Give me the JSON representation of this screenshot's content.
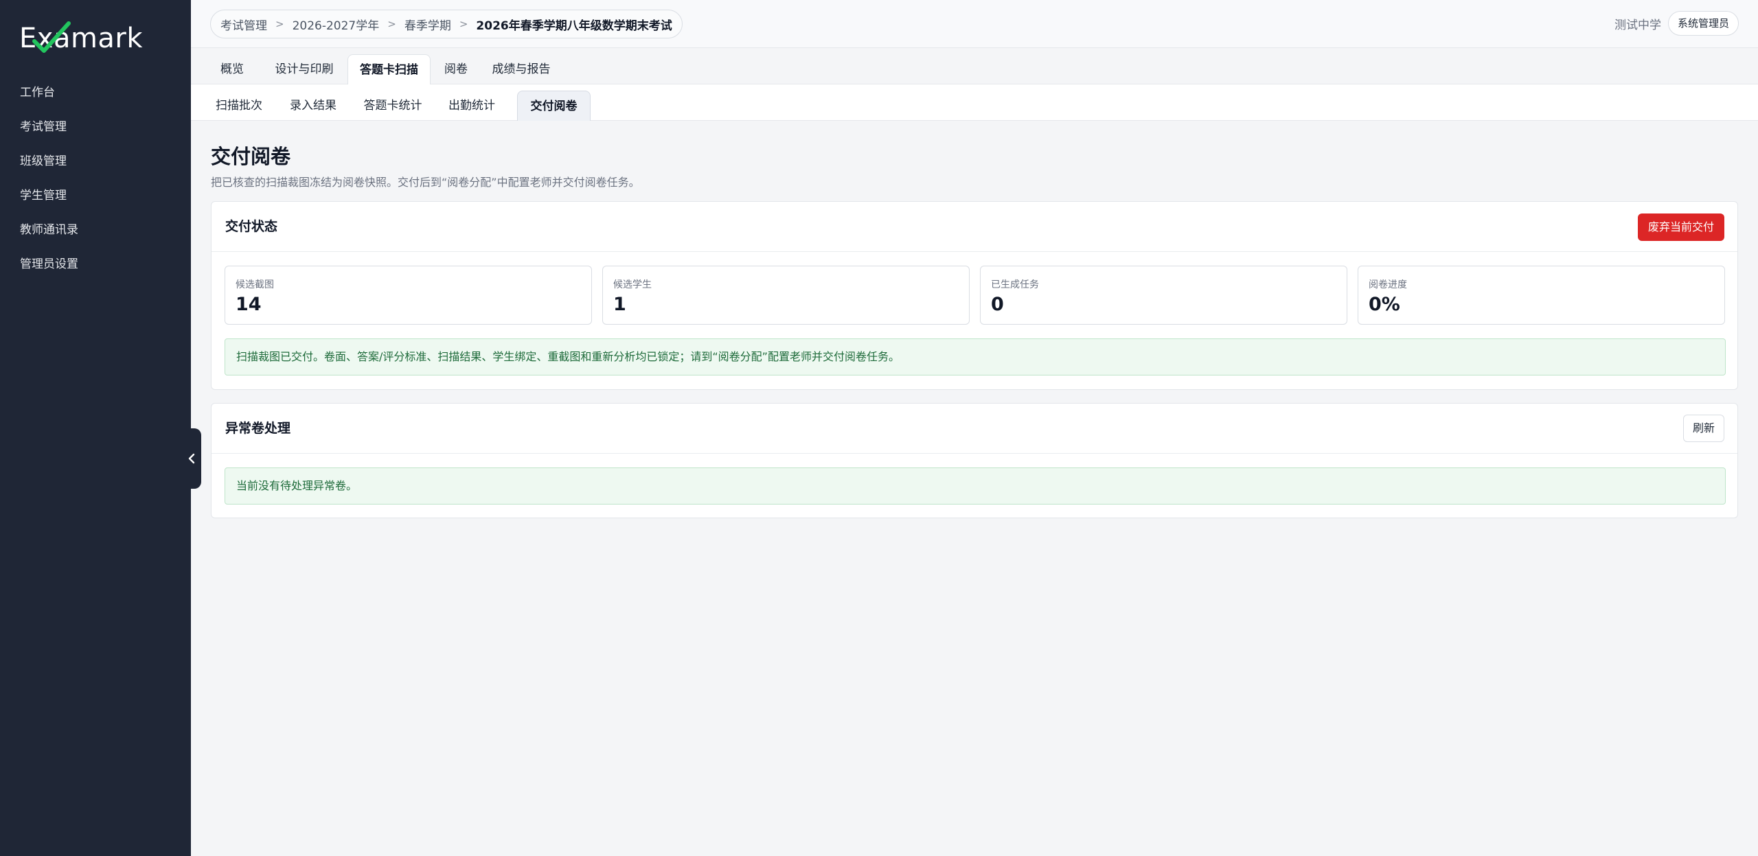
{
  "app": {
    "logo_text": "Examark"
  },
  "sidebar": {
    "items": [
      {
        "label": "工作台"
      },
      {
        "label": "考试管理"
      },
      {
        "label": "班级管理"
      },
      {
        "label": "学生管理"
      },
      {
        "label": "教师通讯录"
      },
      {
        "label": "管理员设置"
      }
    ],
    "collapse_icon": "chevron-left-icon"
  },
  "header": {
    "breadcrumb": [
      "考试管理",
      "2026-2027学年",
      "春季学期",
      "2026年春季学期八年级数学期末考试"
    ],
    "separator": ">",
    "school": "测试中学",
    "role": "系统管理员"
  },
  "tabs": [
    {
      "label": "概览",
      "active": false
    },
    {
      "label": "设计与印刷",
      "active": false
    },
    {
      "label": "答题卡扫描",
      "active": true
    },
    {
      "label": "阅卷",
      "active": false
    },
    {
      "label": "成绩与报告",
      "active": false
    }
  ],
  "subtabs": [
    {
      "label": "扫描批次",
      "active": false
    },
    {
      "label": "录入结果",
      "active": false
    },
    {
      "label": "答题卡统计",
      "active": false
    },
    {
      "label": "出勤统计",
      "active": false
    },
    {
      "label": "交付阅卷",
      "active": true
    }
  ],
  "main": {
    "title": "交付阅卷",
    "description": "把已核查的扫描裁图冻结为阅卷快照。交付后到“阅卷分配”中配置老师并交付阅卷任务。",
    "delivery": {
      "title": "交付状态",
      "discard_label": "废弃当前交付",
      "stats": [
        {
          "label": "候选截图",
          "value": "14"
        },
        {
          "label": "候选学生",
          "value": "1"
        },
        {
          "label": "已生成任务",
          "value": "0"
        },
        {
          "label": "阅卷进度",
          "value": "0%"
        }
      ],
      "notice": "扫描裁图已交付。卷面、答案/评分标准、扫描结果、学生绑定、重截图和重新分析均已锁定；请到“阅卷分配”配置老师并交付阅卷任务。"
    },
    "exceptions": {
      "title": "异常卷处理",
      "refresh_label": "刷新",
      "notice": "当前没有待处理异常卷。"
    }
  },
  "colors": {
    "sidebar_bg": "#1f2636",
    "danger": "#dc2626",
    "success_bg": "#eef9f1",
    "success_text": "#1e6b3a",
    "logo_check": "#22c55e"
  }
}
